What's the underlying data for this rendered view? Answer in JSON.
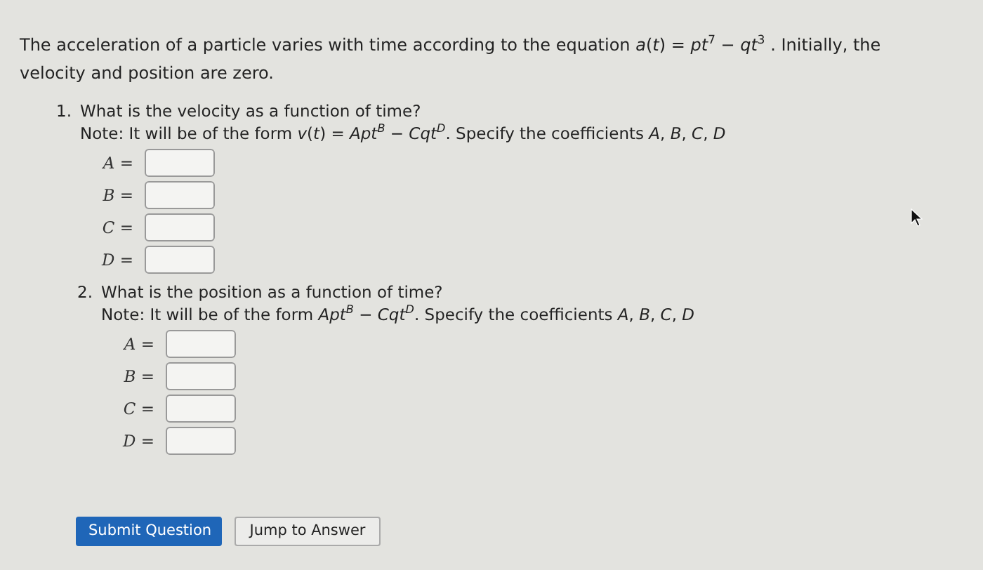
{
  "intro": "The acceleration of a particle varies with time according to the equation *a*(*t*) = *pt*$^{7}$ − *qt*$^{3}$ . Initially, the velocity and position are zero.",
  "questions": [
    {
      "number": "1.",
      "prompt": "What is the velocity as a function of time?",
      "note": "Note: It will be of the form *v*(*t*) = *Apt*$^{B}$ − *Cqt*$^{D}$. Specify the coefficients *A*, *B*, *C*, *D*",
      "fields": [
        {
          "label": "A ="
        },
        {
          "label": "B ="
        },
        {
          "label": "C ="
        },
        {
          "label": "D ="
        }
      ]
    },
    {
      "number": "2.",
      "prompt": "What is the position as a function of time?",
      "note": "Note: It will be of the form *Apt*$^{B}$ − *Cqt*$^{D}$. Specify the coefficients *A*, *B*, *C*, *D*",
      "fields": [
        {
          "label": "A ="
        },
        {
          "label": "B ="
        },
        {
          "label": "C ="
        },
        {
          "label": "D ="
        }
      ]
    }
  ],
  "buttons": [
    {
      "label": "Submit Question",
      "kind": "primary"
    },
    {
      "label": "Jump to Answer",
      "kind": "secondary"
    }
  ]
}
